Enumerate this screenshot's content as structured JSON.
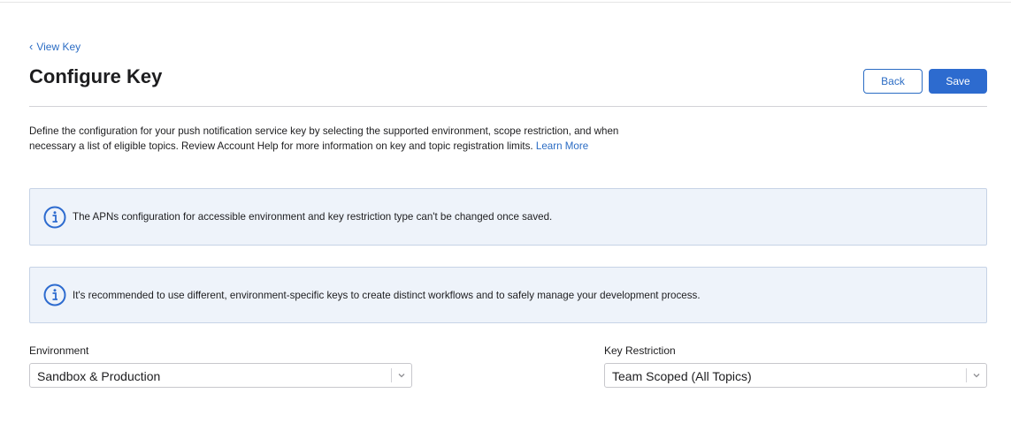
{
  "nav": {
    "back_link_label": "View Key",
    "back_chevron": "‹"
  },
  "header": {
    "title": "Configure Key",
    "back_button": "Back",
    "save_button": "Save"
  },
  "description": {
    "text": "Define the configuration for your push notification service key by selecting the supported environment, scope restriction, and when necessary a list of eligible topics. Review Account Help for more information on key and topic registration limits.",
    "learn_more": "Learn More"
  },
  "notices": [
    {
      "icon": "info-icon",
      "text": "The APNs configuration for accessible environment and key restriction type can't be changed once saved."
    },
    {
      "icon": "info-icon",
      "text": "It's recommended to use different, environment-specific keys to create distinct workflows and to safely manage your development process."
    }
  ],
  "fields": {
    "environment": {
      "label": "Environment",
      "value": "Sandbox & Production"
    },
    "key_restriction": {
      "label": "Key Restriction",
      "value": "Team Scoped (All Topics)"
    }
  },
  "colors": {
    "accent": "#2d6bcf",
    "link": "#2b6cc4",
    "notice_bg": "#eef3fa",
    "notice_border": "#c6d3e6"
  }
}
